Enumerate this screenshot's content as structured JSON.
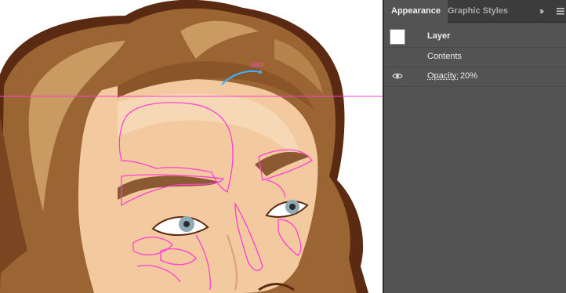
{
  "panel": {
    "tabs": [
      {
        "label": "Appearance",
        "active": true
      },
      {
        "label": "Graphic Styles",
        "active": false
      }
    ],
    "collapse_icon": "double-chevron-right-icon",
    "menu_icon": "panel-menu-icon",
    "rows": {
      "layer": {
        "label": "Layer",
        "swatch_color": "#ffffff"
      },
      "contents": {
        "label": "Contents"
      },
      "opacity": {
        "name": "Opacity:",
        "value": "20%",
        "icon": "eye-icon"
      }
    }
  },
  "canvas": {
    "selection_label": "path",
    "guide_color": "#ff3fd5",
    "path_color": "#ff3fd5",
    "selection_path_color": "#38b6ff"
  }
}
